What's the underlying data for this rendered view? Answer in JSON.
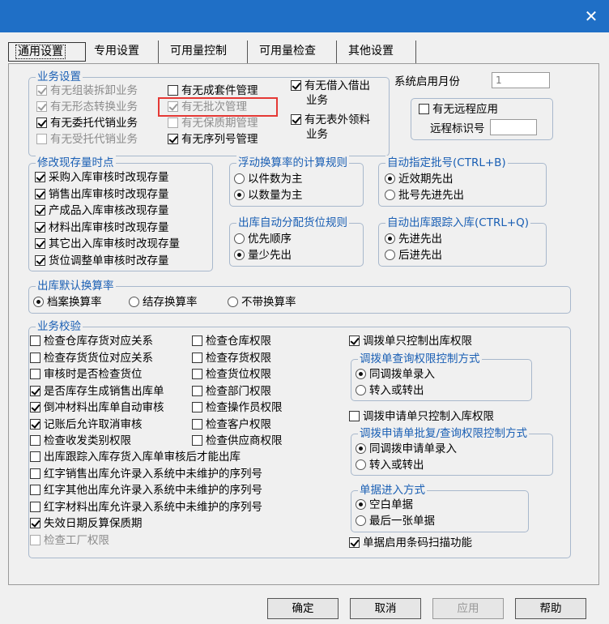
{
  "window": {
    "close_glyph": "✕"
  },
  "tabs": [
    "通用设置",
    "专用设置",
    "可用量控制",
    "可用量检查",
    "其他设置"
  ],
  "business": {
    "title": "业务设置",
    "col1": [
      {
        "label": "有无组装拆卸业务",
        "checked": true,
        "disabled": true
      },
      {
        "label": "有无形态转换业务",
        "checked": true,
        "disabled": true
      },
      {
        "label": "有无委托代销业务",
        "checked": true,
        "disabled": false
      },
      {
        "label": "有无受托代销业务",
        "checked": false,
        "disabled": true
      }
    ],
    "col2": [
      {
        "label": "有无成套件管理",
        "checked": false,
        "disabled": false
      },
      {
        "label": "有无批次管理",
        "checked": true,
        "disabled": true
      },
      {
        "label": "有无保质期管理",
        "checked": false,
        "disabled": true
      },
      {
        "label": "有无序列号管理",
        "checked": true,
        "disabled": false
      }
    ],
    "borrow_line1": "有无借入借出",
    "borrow_line2": "业务",
    "outside_line1": "有无表外领料",
    "outside_line2": "业务",
    "start_month_label": "系统启用月份",
    "start_month_value": "1",
    "remote_app_label": "有无远程应用",
    "remote_id_label": "远程标识号",
    "remote_id_value": ""
  },
  "modify_stock": {
    "title": "修改现存量时点",
    "items": [
      "采购入库审核时改现存量",
      "销售出库审核时改现存量",
      "产成品入库审核改现存量",
      "材料出库审核时改现存量",
      "其它出入库审核时改现存量",
      "货位调整单审核时改存量"
    ]
  },
  "float_rate": {
    "title": "浮动换算率的计算规则",
    "options": [
      "以件数为主",
      "以数量为主"
    ],
    "selected": 1
  },
  "auto_batch": {
    "title": "自动指定批号(CTRL+B)",
    "options": [
      "近效期先出",
      "批号先进先出"
    ],
    "selected": 0
  },
  "auto_location": {
    "title": "出库自动分配货位规则",
    "options": [
      "优先顺序",
      "量少先出"
    ],
    "selected": 1
  },
  "auto_track": {
    "title": "自动出库跟踪入库(CTRL+Q)",
    "options": [
      "先进先出",
      "后进先出"
    ],
    "selected": 0
  },
  "default_rate": {
    "title": "出库默认换算率",
    "options": [
      "档案换算率",
      "结存换算率",
      "不带换算率"
    ],
    "selected": 0
  },
  "verify": {
    "title": "业务校验",
    "col1": [
      {
        "label": "检查仓库存货对应关系",
        "checked": false,
        "disabled": false
      },
      {
        "label": "检查存货货位对应关系",
        "checked": false,
        "disabled": false
      },
      {
        "label": "审核时是否检查货位",
        "checked": false,
        "disabled": false
      },
      {
        "label": "是否库存生成销售出库单",
        "checked": true,
        "disabled": false
      },
      {
        "label": "倒冲材料出库单自动审核",
        "checked": true,
        "disabled": false
      },
      {
        "label": "记账后允许取消审核",
        "checked": true,
        "disabled": false
      },
      {
        "label": "检查收发类别权限",
        "checked": false,
        "disabled": false
      }
    ],
    "col2": [
      {
        "label": "检查仓库权限",
        "checked": false
      },
      {
        "label": "检查存货权限",
        "checked": false
      },
      {
        "label": "检查货位权限",
        "checked": false
      },
      {
        "label": "检查部门权限",
        "checked": false
      },
      {
        "label": "检查操作员权限",
        "checked": false
      },
      {
        "label": "检查客户权限",
        "checked": false
      },
      {
        "label": "检查供应商权限",
        "checked": false
      }
    ],
    "long": [
      {
        "label": "出库跟踪入库存货入库单审核后才能出库",
        "checked": false,
        "disabled": false
      },
      {
        "label": "红字销售出库允许录入系统中未维护的序列号",
        "checked": false,
        "disabled": false
      },
      {
        "label": "红字其他出库允许录入系统中未维护的序列号",
        "checked": false,
        "disabled": false
      },
      {
        "label": "红字材料出库允许录入系统中未维护的序列号",
        "checked": false,
        "disabled": false
      },
      {
        "label": "失效日期反算保质期",
        "checked": true,
        "disabled": false
      },
      {
        "label": "检查工厂权限",
        "checked": false,
        "disabled": true
      }
    ],
    "transfer_out_label": "调拨单只控制出库权限",
    "transfer_query": {
      "title": "调拨单查询权限控制方式",
      "options": [
        "同调拨单录入",
        "转入或转出"
      ],
      "selected": 0
    },
    "transfer_in_label": "调拨申请单只控制入库权限",
    "apply_query": {
      "title": "调拨申请单批复/查询权限控制方式",
      "options": [
        "同调拨申请单录入",
        "转入或转出"
      ],
      "selected": 0
    },
    "entry_mode": {
      "title": "单据进入方式",
      "options": [
        "空白单据",
        "最后一张单据"
      ],
      "selected": 0
    },
    "barcode_label": "单据启用条码扫描功能"
  },
  "buttons": {
    "ok": "确定",
    "cancel": "取消",
    "apply": "应用",
    "help": "帮助"
  }
}
